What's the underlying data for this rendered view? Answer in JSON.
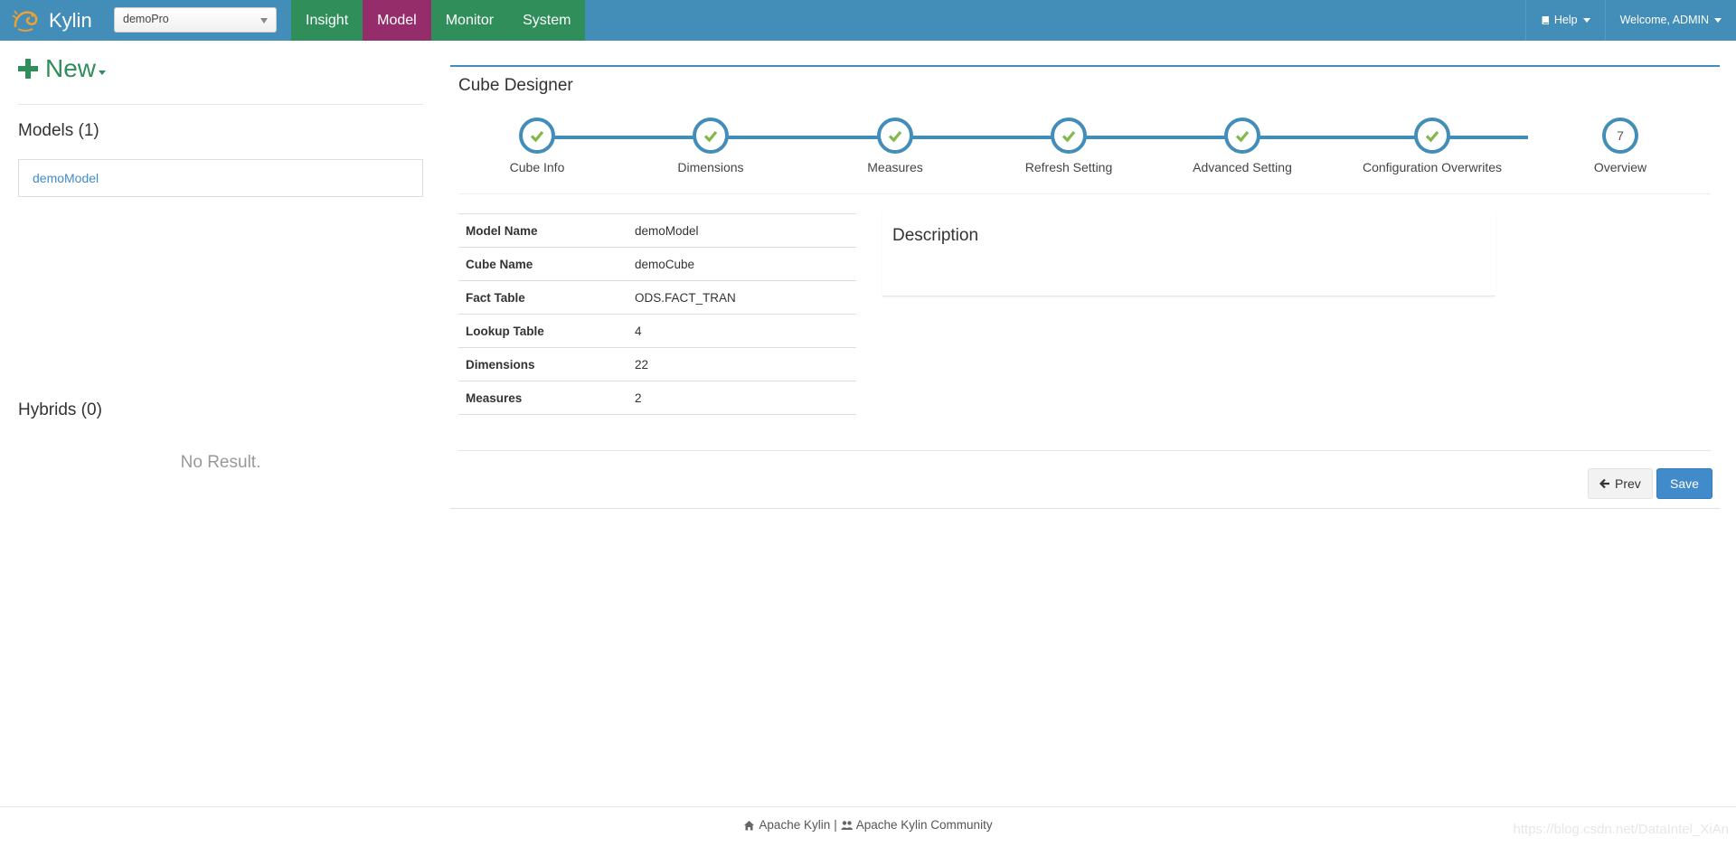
{
  "navbar": {
    "brand": "Kylin",
    "project": "demoPro",
    "tabs": [
      {
        "label": "Insight",
        "active": false
      },
      {
        "label": "Model",
        "active": true
      },
      {
        "label": "Monitor",
        "active": false
      },
      {
        "label": "System",
        "active": false
      }
    ],
    "help_label": "Help",
    "welcome_label": "Welcome, ADMIN"
  },
  "sidebar": {
    "new_label": "New",
    "models_title": "Models (1)",
    "models": [
      "demoModel"
    ],
    "hybrids_title": "Hybrids (0)",
    "no_result": "No Result."
  },
  "designer": {
    "title": "Cube Designer",
    "steps": [
      {
        "label": "Cube Info",
        "state": "done"
      },
      {
        "label": "Dimensions",
        "state": "done"
      },
      {
        "label": "Measures",
        "state": "done"
      },
      {
        "label": "Refresh Setting",
        "state": "done"
      },
      {
        "label": "Advanced Setting",
        "state": "done"
      },
      {
        "label": "Configuration Overwrites",
        "state": "done"
      },
      {
        "label": "Overview",
        "state": "current",
        "number": "7"
      }
    ],
    "overview": [
      {
        "key": "Model Name",
        "value": "demoModel"
      },
      {
        "key": "Cube Name",
        "value": "demoCube"
      },
      {
        "key": "Fact Table",
        "value": "ODS.FACT_TRAN"
      },
      {
        "key": "Lookup Table",
        "value": "4"
      },
      {
        "key": "Dimensions",
        "value": "22"
      },
      {
        "key": "Measures",
        "value": "2"
      }
    ],
    "description_title": "Description",
    "prev_label": "Prev",
    "save_label": "Save"
  },
  "footer": {
    "link1": "Apache Kylin",
    "separator": "|",
    "link2": "Apache Kylin Community",
    "watermark": "https://blog.csdn.net/DataIntel_XiAn"
  },
  "colors": {
    "navbar": "#438eb9",
    "tab_green": "#2f8e5a",
    "tab_active": "#952d6a",
    "check": "#82b74b",
    "save_button": "#428bca"
  }
}
